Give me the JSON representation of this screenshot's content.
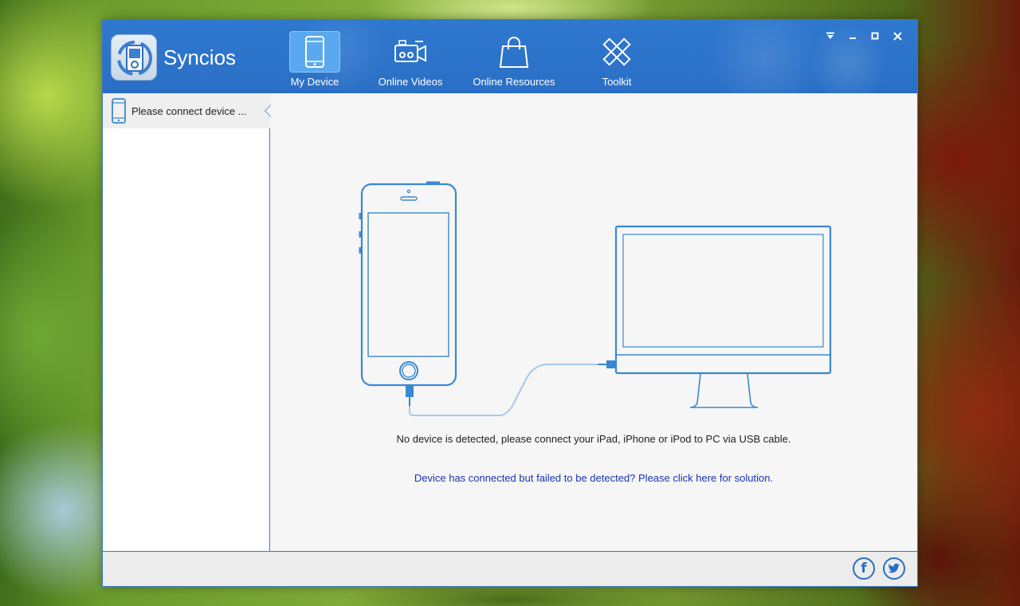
{
  "app": {
    "name": "Syncios"
  },
  "nav": [
    {
      "label": "My Device",
      "icon": "phone-icon",
      "active": true
    },
    {
      "label": "Online Videos",
      "icon": "video-camera-icon",
      "active": false
    },
    {
      "label": "Online Resources",
      "icon": "shopping-bag-icon",
      "active": false
    },
    {
      "label": "Toolkit",
      "icon": "toolkit-pencil-ruler-icon",
      "active": false
    }
  ],
  "window_controls": [
    "dropdown-menu-icon",
    "minimize-icon",
    "maximize-icon",
    "close-icon"
  ],
  "sidebar": {
    "device_label": "Please connect device ..."
  },
  "main": {
    "message": "No device is detected, please connect your iPad, iPhone or iPod to PC via USB cable.",
    "help_link": "Device has connected but failed to be detected? Please click here for solution."
  },
  "footer": {
    "social": [
      "facebook-icon",
      "twitter-icon"
    ]
  },
  "colors": {
    "accent": "#2a6fc6",
    "outline": "#3a88d0",
    "link": "#1a33b3",
    "active_nav": "#5aa9f0"
  }
}
